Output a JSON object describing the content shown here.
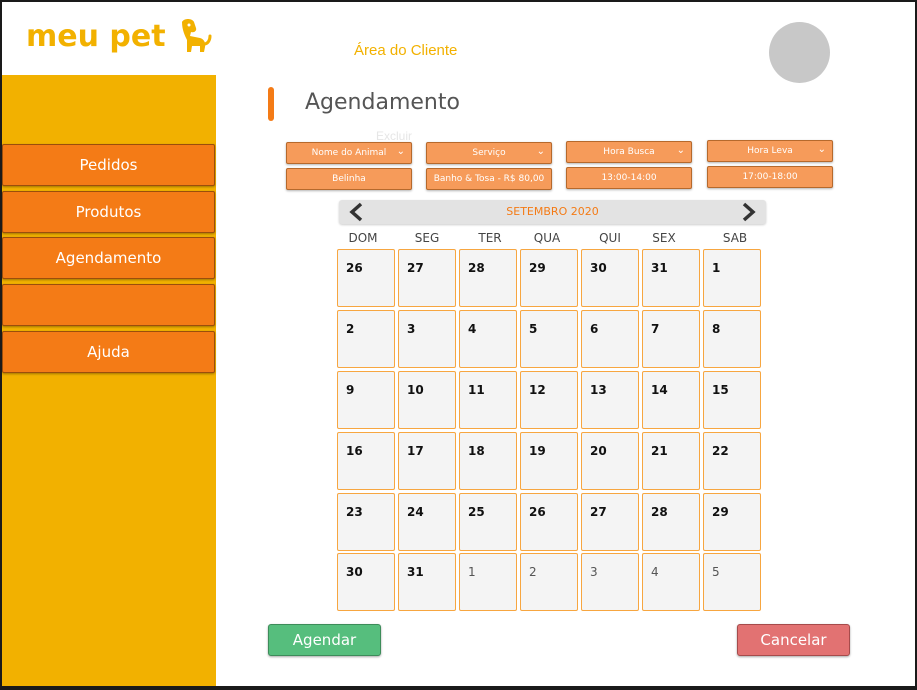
{
  "header": {
    "logo_text": "meu pet",
    "logo_icon": "dog-icon",
    "area_title": "Área do Cliente",
    "avatar_icon": "user-avatar"
  },
  "sidebar": {
    "items": [
      {
        "label": "Pedidos"
      },
      {
        "label": "Produtos"
      },
      {
        "label": "Agendamento"
      },
      {
        "label": ""
      },
      {
        "label": "Ajuda"
      }
    ]
  },
  "main": {
    "title": "Agendamento",
    "ghost_text": "Excluir",
    "filters": [
      {
        "label": "Nome do Animal",
        "value": "Belinha"
      },
      {
        "label": "Serviço",
        "value": "Banho & Tosa - R$ 80,00"
      },
      {
        "label": "Hora Busca",
        "value": "13:00-14:00"
      },
      {
        "label": "Hora Leva",
        "value": "17:00-18:00"
      }
    ]
  },
  "calendar": {
    "month": "SETEMBRO 2020",
    "weekdays": [
      "DOM",
      "SEG",
      "TER",
      "QUA",
      "QUI",
      "SEX",
      "SAB"
    ],
    "weeks": [
      [
        "26",
        "27",
        "28",
        "29",
        "30",
        "31",
        "1"
      ],
      [
        "2",
        "3",
        "4",
        "5",
        "6",
        "7",
        "8"
      ],
      [
        "9",
        "10",
        "11",
        "12",
        "13",
        "14",
        "15"
      ],
      [
        "16",
        "17",
        "18",
        "19",
        "20",
        "21",
        "22"
      ],
      [
        "23",
        "24",
        "25",
        "26",
        "27",
        "28",
        "29"
      ],
      [
        "30",
        "31",
        "1",
        "2",
        "3",
        "4",
        "5"
      ]
    ]
  },
  "actions": {
    "submit_label": "Agendar",
    "cancel_label": "Cancelar"
  },
  "colors": {
    "brand_yellow": "#f2b100",
    "brand_orange": "#f47b16",
    "green": "#56be7d",
    "red": "#e27272"
  }
}
